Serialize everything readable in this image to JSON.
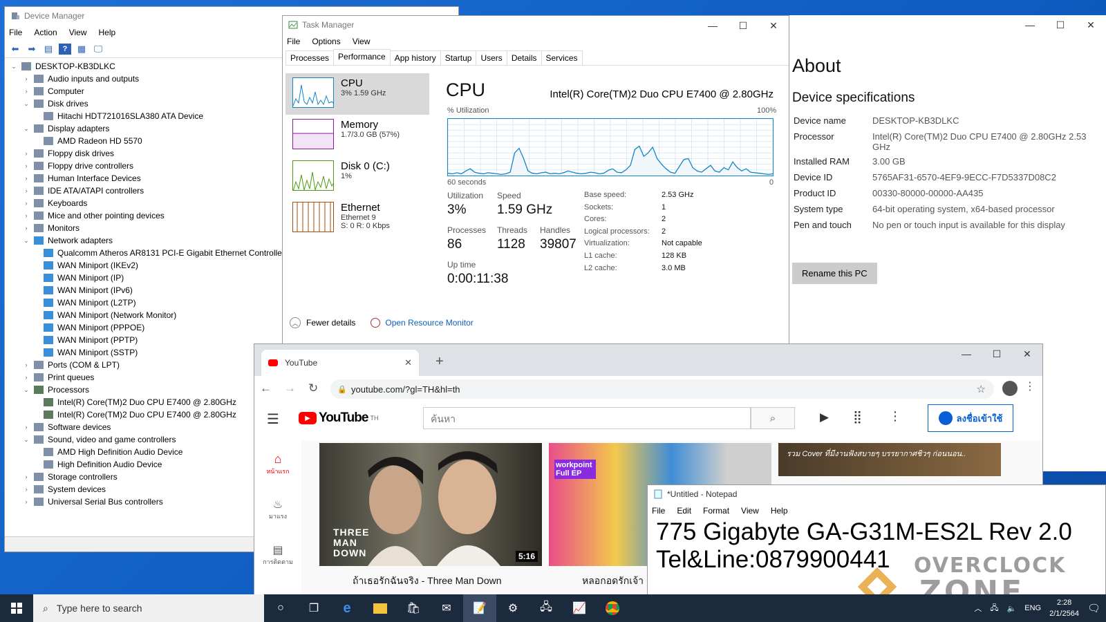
{
  "colors": {
    "desktop": "#1263c9",
    "cpu_graph": "#1185c8",
    "memory_graph": "#8b1aa0",
    "disk_graph": "#4a9c10",
    "ethernet_graph": "#a84d0a",
    "youtube_red": "#ff0000",
    "link_blue": "#065fd4"
  },
  "device_manager": {
    "title": "Device Manager",
    "menu": [
      "File",
      "Action",
      "View",
      "Help"
    ],
    "toolbar_icons": [
      "back-arrow-icon",
      "forward-arrow-icon",
      "properties-icon",
      "help-icon",
      "update-driver-icon",
      "monitor-icon"
    ],
    "root": "DESKTOP-KB3DLKC",
    "nodes": [
      {
        "label": "Audio inputs and outputs",
        "level": 1,
        "expander": "collapsed",
        "icon": "speaker-icon"
      },
      {
        "label": "Computer",
        "level": 1,
        "expander": "collapsed",
        "icon": "computer-icon"
      },
      {
        "label": "Disk drives",
        "level": 1,
        "expander": "expanded",
        "icon": "disk-drive-icon"
      },
      {
        "label": "Hitachi HDT721016SLA380 ATA Device",
        "level": 2,
        "expander": "none",
        "icon": "disk-drive-icon"
      },
      {
        "label": "Display adapters",
        "level": 1,
        "expander": "expanded",
        "icon": "display-adapter-icon"
      },
      {
        "label": "AMD Radeon HD 5570",
        "level": 2,
        "expander": "none",
        "icon": "display-adapter-icon"
      },
      {
        "label": "Floppy disk drives",
        "level": 1,
        "expander": "collapsed",
        "icon": "floppy-icon"
      },
      {
        "label": "Floppy drive controllers",
        "level": 1,
        "expander": "collapsed",
        "icon": "controller-icon"
      },
      {
        "label": "Human Interface Devices",
        "level": 1,
        "expander": "collapsed",
        "icon": "hid-icon"
      },
      {
        "label": "IDE ATA/ATAPI controllers",
        "level": 1,
        "expander": "collapsed",
        "icon": "controller-icon"
      },
      {
        "label": "Keyboards",
        "level": 1,
        "expander": "collapsed",
        "icon": "keyboard-icon"
      },
      {
        "label": "Mice and other pointing devices",
        "level": 1,
        "expander": "collapsed",
        "icon": "mouse-icon"
      },
      {
        "label": "Monitors",
        "level": 1,
        "expander": "collapsed",
        "icon": "monitor-icon"
      },
      {
        "label": "Network adapters",
        "level": 1,
        "expander": "expanded",
        "icon": "network-adapter-icon"
      },
      {
        "label": "Qualcomm Atheros AR8131 PCI-E Gigabit Ethernet Controlle",
        "level": 2,
        "expander": "none",
        "icon": "network-adapter-icon"
      },
      {
        "label": "WAN Miniport (IKEv2)",
        "level": 2,
        "expander": "none",
        "icon": "network-adapter-icon"
      },
      {
        "label": "WAN Miniport (IP)",
        "level": 2,
        "expander": "none",
        "icon": "network-adapter-icon"
      },
      {
        "label": "WAN Miniport (IPv6)",
        "level": 2,
        "expander": "none",
        "icon": "network-adapter-icon"
      },
      {
        "label": "WAN Miniport (L2TP)",
        "level": 2,
        "expander": "none",
        "icon": "network-adapter-icon"
      },
      {
        "label": "WAN Miniport (Network Monitor)",
        "level": 2,
        "expander": "none",
        "icon": "network-adapter-icon"
      },
      {
        "label": "WAN Miniport (PPPOE)",
        "level": 2,
        "expander": "none",
        "icon": "network-adapter-icon"
      },
      {
        "label": "WAN Miniport (PPTP)",
        "level": 2,
        "expander": "none",
        "icon": "network-adapter-icon"
      },
      {
        "label": "WAN Miniport (SSTP)",
        "level": 2,
        "expander": "none",
        "icon": "network-adapter-icon"
      },
      {
        "label": "Ports (COM & LPT)",
        "level": 1,
        "expander": "collapsed",
        "icon": "port-icon"
      },
      {
        "label": "Print queues",
        "level": 1,
        "expander": "collapsed",
        "icon": "printer-icon"
      },
      {
        "label": "Processors",
        "level": 1,
        "expander": "expanded",
        "icon": "processor-icon"
      },
      {
        "label": "Intel(R) Core(TM)2 Duo CPU     E7400  @ 2.80GHz",
        "level": 2,
        "expander": "none",
        "icon": "processor-icon"
      },
      {
        "label": "Intel(R) Core(TM)2 Duo CPU     E7400  @ 2.80GHz",
        "level": 2,
        "expander": "none",
        "icon": "processor-icon"
      },
      {
        "label": "Software devices",
        "level": 1,
        "expander": "collapsed",
        "icon": "software-device-icon"
      },
      {
        "label": "Sound, video and game controllers",
        "level": 1,
        "expander": "expanded",
        "icon": "speaker-icon"
      },
      {
        "label": "AMD High Definition Audio Device",
        "level": 2,
        "expander": "none",
        "icon": "speaker-icon"
      },
      {
        "label": "High Definition Audio Device",
        "level": 2,
        "expander": "none",
        "icon": "speaker-icon"
      },
      {
        "label": "Storage controllers",
        "level": 1,
        "expander": "collapsed",
        "icon": "storage-icon"
      },
      {
        "label": "System devices",
        "level": 1,
        "expander": "collapsed",
        "icon": "system-icon"
      },
      {
        "label": "Universal Serial Bus controllers",
        "level": 1,
        "expander": "collapsed",
        "icon": "usb-icon"
      }
    ]
  },
  "about": {
    "title": "About",
    "section": "Device specifications",
    "specs": [
      {
        "key": "Device name",
        "value": "DESKTOP-KB3DLKC"
      },
      {
        "key": "Processor",
        "value": "Intel(R) Core(TM)2 Duo CPU     E7400  @ 2.80GHz   2.53 GHz"
      },
      {
        "key": "Installed RAM",
        "value": "3.00 GB"
      },
      {
        "key": "Device ID",
        "value": "5765AF31-6570-4EF9-9ECC-F7D5337D08C2"
      },
      {
        "key": "Product ID",
        "value": "00330-80000-00000-AA435"
      },
      {
        "key": "System type",
        "value": "64-bit operating system, x64-based processor"
      },
      {
        "key": "Pen and touch",
        "value": "No pen or touch input is available for this display"
      }
    ],
    "rename_button": "Rename this PC"
  },
  "task_manager": {
    "title": "Task Manager",
    "menu": [
      "File",
      "Options",
      "View"
    ],
    "tabs": [
      "Processes",
      "Performance",
      "App history",
      "Startup",
      "Users",
      "Details",
      "Services"
    ],
    "active_tab": "Performance",
    "side": [
      {
        "name": "CPU",
        "sub1": "3%  1.59 GHz",
        "sub2": ""
      },
      {
        "name": "Memory",
        "sub1": "1.7/3.0 GB (57%)",
        "sub2": ""
      },
      {
        "name": "Disk 0 (C:)",
        "sub1": "1%",
        "sub2": ""
      },
      {
        "name": "Ethernet",
        "sub1": "Ethernet 9",
        "sub2": "S: 0 R: 0 Kbps"
      }
    ],
    "heading": "CPU",
    "model": "Intel(R) Core(TM)2 Duo CPU E7400 @ 2.80GHz",
    "util_label": "% Utilization",
    "util_max": "100%",
    "time_span": "60 seconds",
    "time_zero": "0",
    "utilization_series": [
      4,
      3,
      5,
      3,
      8,
      12,
      6,
      4,
      3,
      5,
      4,
      3,
      2,
      3,
      6,
      40,
      48,
      30,
      8,
      4,
      3,
      5,
      6,
      3,
      4,
      3,
      5,
      8,
      6,
      4,
      3,
      4,
      6,
      5,
      3,
      4,
      9,
      12,
      6,
      5,
      10,
      18,
      46,
      52,
      34,
      40,
      50,
      30,
      20,
      12,
      6,
      4,
      16,
      28,
      30,
      14,
      8,
      6,
      12,
      18,
      8,
      6,
      14,
      10,
      24,
      14,
      8,
      12,
      6,
      5,
      4,
      3,
      2,
      3
    ],
    "stats": {
      "utilization_label": "Utilization",
      "utilization": "3%",
      "speed_label": "Speed",
      "speed": "1.59 GHz",
      "processes_label": "Processes",
      "processes": "86",
      "threads_label": "Threads",
      "threads": "1128",
      "handles_label": "Handles",
      "handles": "39807",
      "uptime_label": "Up time",
      "uptime": "0:00:11:38"
    },
    "details": [
      {
        "k": "Base speed:",
        "v": "2.53 GHz"
      },
      {
        "k": "Sockets:",
        "v": "1"
      },
      {
        "k": "Cores:",
        "v": "2"
      },
      {
        "k": "Logical processors:",
        "v": "2"
      },
      {
        "k": "Virtualization:",
        "v": "Not capable"
      },
      {
        "k": "L1 cache:",
        "v": "128 KB"
      },
      {
        "k": "L2 cache:",
        "v": "3.0 MB"
      }
    ],
    "fewer_details": "Fewer details",
    "open_resource_monitor": "Open Resource Monitor"
  },
  "chrome": {
    "tab_title": "YouTube",
    "url": "youtube.com/?gl=TH&hl=th",
    "youtube": {
      "logo": "YouTube",
      "region": "TH",
      "search_placeholder": "ค้นหา",
      "signin": "ลงชื่อเข้าใช้",
      "side": [
        "หน้าแรก",
        "มาแรง",
        "การติดตาม"
      ],
      "video1_title": "ถ้าเธอรักฉันจริง - Three Man Down",
      "video1_duration": "5:16",
      "video1_overlay": "THREE\nMAN\nDOWN",
      "video2_title": "หลอกอดรักเจ้า",
      "video2_overlay": "workpoint Full EP",
      "video3_banner": "รวม Cover ที่มีงานฟังสบายๆ บรรยากาศชิวๆ ก่อนนอน.."
    }
  },
  "notepad": {
    "title": "*Untitled - Notepad",
    "menu": [
      "File",
      "Edit",
      "Format",
      "View",
      "Help"
    ],
    "lines": [
      "775 Gigabyte GA-G31M-ES2L Rev 2.0",
      "Tel&Line:0879900441"
    ]
  },
  "taskbar": {
    "search_placeholder": "Type here to search",
    "apps": [
      "task-view-icon",
      "edge-icon",
      "file-explorer-icon",
      "store-icon",
      "mail-icon",
      "notepad-icon",
      "settings-icon",
      "device-manager-icon",
      "task-manager-icon",
      "chrome-icon"
    ],
    "lang": "ENG",
    "time": "2:28",
    "date": "2/1/2564"
  },
  "watermark": {
    "line1": "OVERCLOCK",
    "line2": "ZONE"
  }
}
